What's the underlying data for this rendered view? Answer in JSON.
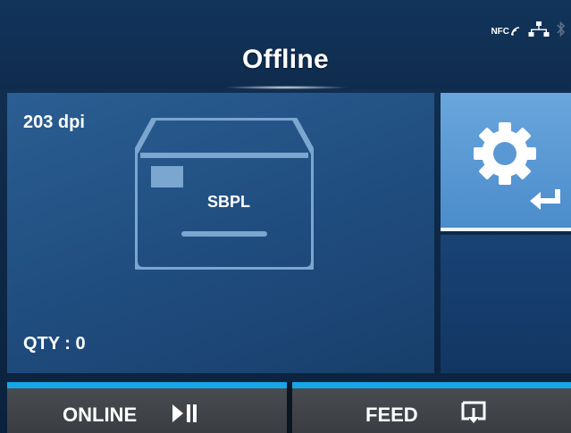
{
  "header": {
    "title": "Offline",
    "status_icons": [
      "nfc-icon",
      "network-icon",
      "bluetooth-icon"
    ],
    "nfc_label": "NFC"
  },
  "panel": {
    "dpi": "203 dpi",
    "language": "SBPL",
    "qty": "QTY : 0"
  },
  "settings": {
    "icons": [
      "gear-icon",
      "enter-icon"
    ]
  },
  "bottom": {
    "online_label": "ONLINE",
    "feed_label": "FEED",
    "accent_color": "#16a6e8"
  }
}
